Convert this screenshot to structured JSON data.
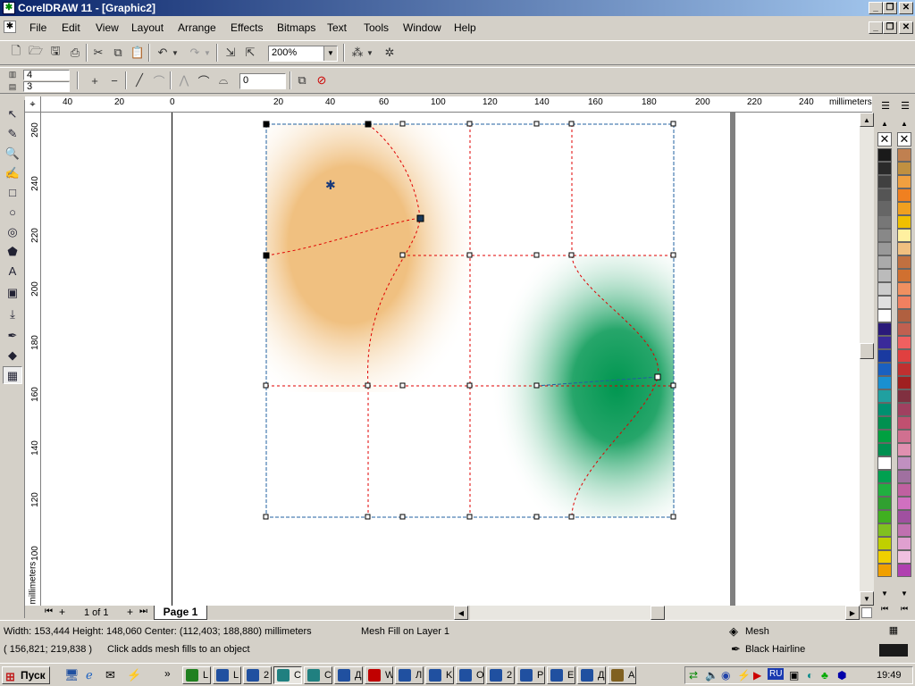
{
  "window": {
    "title": "CorelDRAW 11 - [Graphic2]"
  },
  "menu": [
    "File",
    "Edit",
    "View",
    "Layout",
    "Arrange",
    "Effects",
    "Bitmaps",
    "Text",
    "Tools",
    "Window",
    "Help"
  ],
  "toolbar": {
    "zoom": "200%"
  },
  "propertybar": {
    "rows": "4",
    "cols": "3",
    "smoothing": "0"
  },
  "ruler": {
    "units": "millimeters",
    "h_ticks": [
      "40",
      "20",
      "0",
      "20",
      "40",
      "60",
      "80",
      "100",
      "120",
      "140",
      "160",
      "180",
      "200",
      "220",
      "240"
    ],
    "v_ticks": [
      "260",
      "240",
      "220",
      "200",
      "180",
      "160",
      "140",
      "120",
      "100"
    ]
  },
  "pages": {
    "counter": "1 of 1",
    "current": "Page 1"
  },
  "status": {
    "dimensions": "Width: 153,444  Height: 148,060  Center: (112,403; 188,880)  millimeters",
    "object": "Mesh Fill on Layer 1",
    "cursor": "( 156,821; 219,838 )",
    "hint": "Click adds mesh fills to an object",
    "fill": "Mesh",
    "outline": "Black  Hairline"
  },
  "taskbar": {
    "start": "Пуск",
    "clock": "19:49",
    "lang": "RU",
    "tasks": [
      "L",
      "L",
      "2",
      "C",
      "C",
      "Д",
      "W",
      "Л",
      "K",
      "O",
      "2",
      "P",
      "E",
      "Д",
      "A"
    ]
  },
  "colors": {
    "title_start": "#0a246a",
    "orange": "#f0c080",
    "green": "#009650",
    "mesh_line": "#e00000",
    "path_line": "#2060a0"
  },
  "palette": {
    "gray": [
      "#1a1a1a",
      "#2a2a2a",
      "#404040",
      "#555555",
      "#666666",
      "#777777",
      "#888888",
      "#999999",
      "#aaaaaa",
      "#bbbbbb",
      "#cccccc",
      "#e0e0e0",
      "#ffffff",
      "#2a1a7a",
      "#3a2a9a",
      "#1a3aa0",
      "#1a60c0",
      "#1a90d0",
      "#20a0a0",
      "#009070",
      "#009050",
      "#00a040",
      "#009050",
      "#ffffff",
      "#00a050",
      "#20b040",
      "#30a030",
      "#40b020",
      "#80c020",
      "#c0d000",
      "#f0d000",
      "#f0a000"
    ],
    "color": [
      "#c08050",
      "#c09040",
      "#f0a040",
      "#f08020",
      "#f0a020",
      "#f0c000",
      "#fff0a0",
      "#f0c080",
      "#c07040",
      "#d07030",
      "#f09060",
      "#f08060",
      "#b06040",
      "#c06050",
      "#f06060",
      "#e04040",
      "#c03030",
      "#a02020",
      "#803040",
      "#a04060",
      "#c05070",
      "#d07090",
      "#e090b0",
      "#c090c0",
      "#a070a0",
      "#c060a0",
      "#d070c0",
      "#a050a0",
      "#c070b0",
      "#e0a0d0",
      "#f0c0e0",
      "#b040b0"
    ]
  }
}
